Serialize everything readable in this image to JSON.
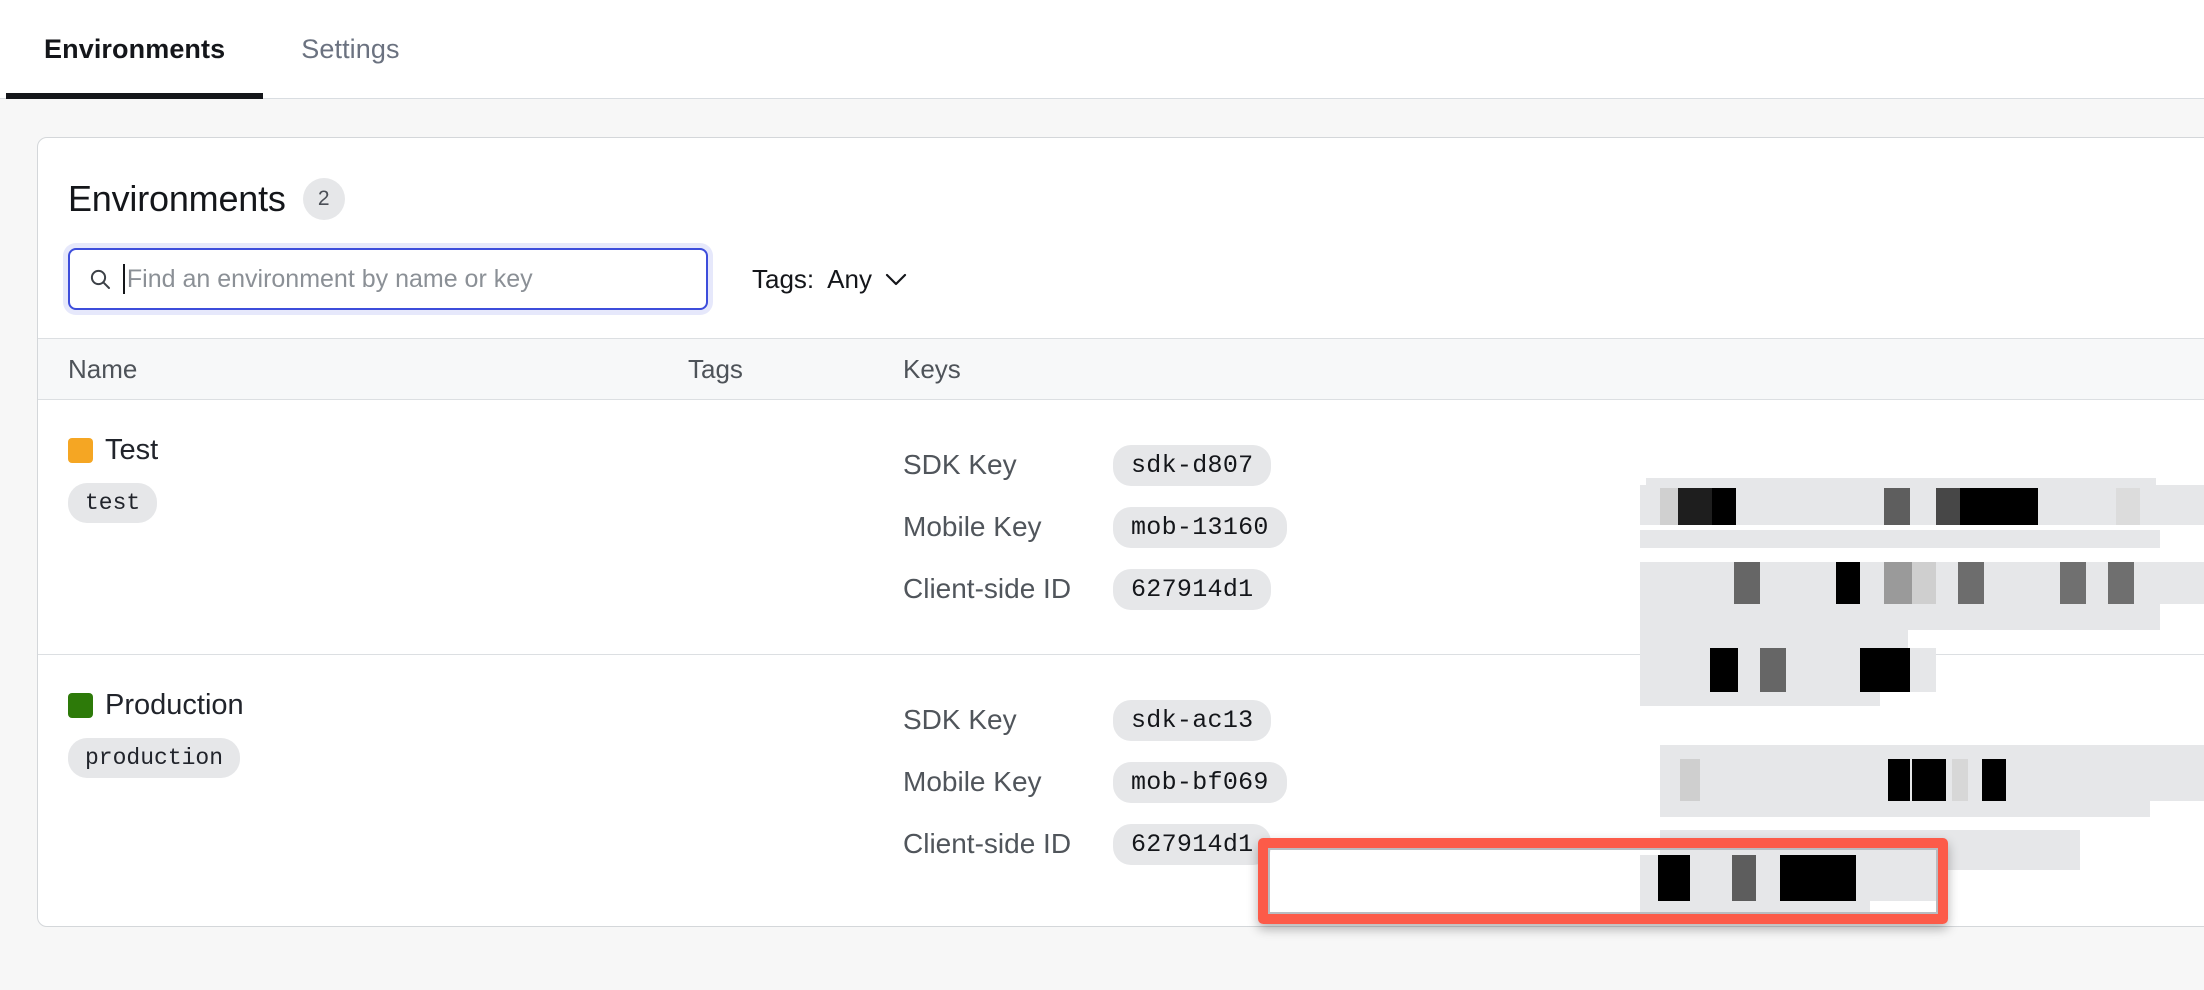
{
  "tabs": [
    {
      "label": "Environments",
      "active": true
    },
    {
      "label": "Settings",
      "active": false
    }
  ],
  "panel": {
    "title": "Environments",
    "count": "2"
  },
  "search": {
    "value": "",
    "placeholder": "Find an environment by name or key",
    "icon": "search-icon"
  },
  "tags_filter": {
    "label": "Tags:",
    "value": "Any",
    "icon": "chevron-down-icon"
  },
  "table": {
    "headers": {
      "name": "Name",
      "tags": "Tags",
      "keys": "Keys"
    },
    "rows": [
      {
        "name": "Test",
        "color": "#f5a623",
        "key_chip": "test",
        "tags": "",
        "keys": [
          {
            "label": "SDK Key",
            "value": "sdk-d807"
          },
          {
            "label": "Mobile Key",
            "value": "mob-13160"
          },
          {
            "label": "Client-side ID",
            "value": "627914d1"
          }
        ]
      },
      {
        "name": "Production",
        "color": "#2d7a09",
        "key_chip": "production",
        "tags": "",
        "keys": [
          {
            "label": "SDK Key",
            "value": "sdk-ac13"
          },
          {
            "label": "Mobile Key",
            "value": "mob-bf069"
          },
          {
            "label": "Client-side ID",
            "value": "627914d1"
          }
        ]
      }
    ]
  },
  "annotation": {
    "target": "production-client-side-id",
    "color": "#fc5b49"
  },
  "colors": {
    "accent": "#3d4ddb",
    "page_bg": "#f7f7f7",
    "card_bg": "#ffffff",
    "chip_bg": "#e6e7e9",
    "border": "#d4d7da",
    "text": "#14161a",
    "muted": "#50555b",
    "highlight": "#fc5b49"
  }
}
